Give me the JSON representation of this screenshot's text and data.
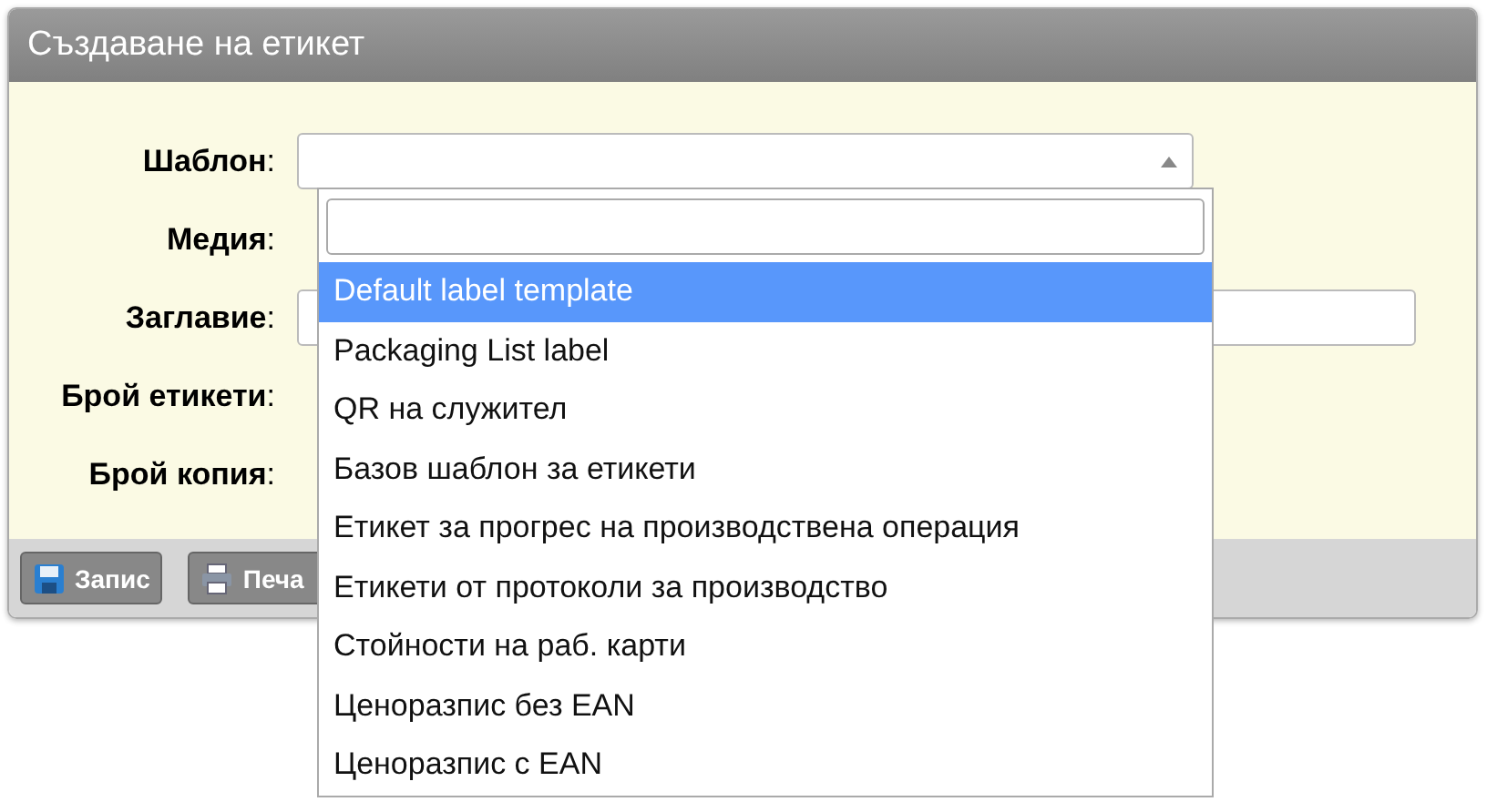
{
  "window": {
    "title": "Създаване на етикет"
  },
  "fields": [
    {
      "label": "**Шаблон**:",
      "kind": "select"
    },
    {
      "label": "**Медия**:",
      "kind": "none"
    },
    {
      "label": "**Заглавие**:",
      "kind": "text"
    },
    {
      "label": "**Брой етикети**:",
      "kind": "none"
    },
    {
      "label": "**Брой копия**:",
      "kind": "none"
    }
  ],
  "dropdown": {
    "options": [
      {
        "label": "Default label template",
        "selected": true
      },
      {
        "label": "Packaging List label",
        "selected": false
      },
      {
        "label": "QR на служител",
        "selected": false
      },
      {
        "label": "Базов шаблон за етикети",
        "selected": false
      },
      {
        "label": "Етикет за прогрес на производствена операция",
        "selected": false
      },
      {
        "label": "Етикети от протоколи за производство",
        "selected": false
      },
      {
        "label": "Стойности на раб. карти",
        "selected": false
      },
      {
        "label": "Ценоразпис без EAN",
        "selected": false
      },
      {
        "label": "Ценоразпис с EAN",
        "selected": false
      }
    ]
  },
  "buttons": [
    {
      "label": "Запис",
      "kind": "save"
    },
    {
      "label": "Печа",
      "kind": "print"
    }
  ]
}
